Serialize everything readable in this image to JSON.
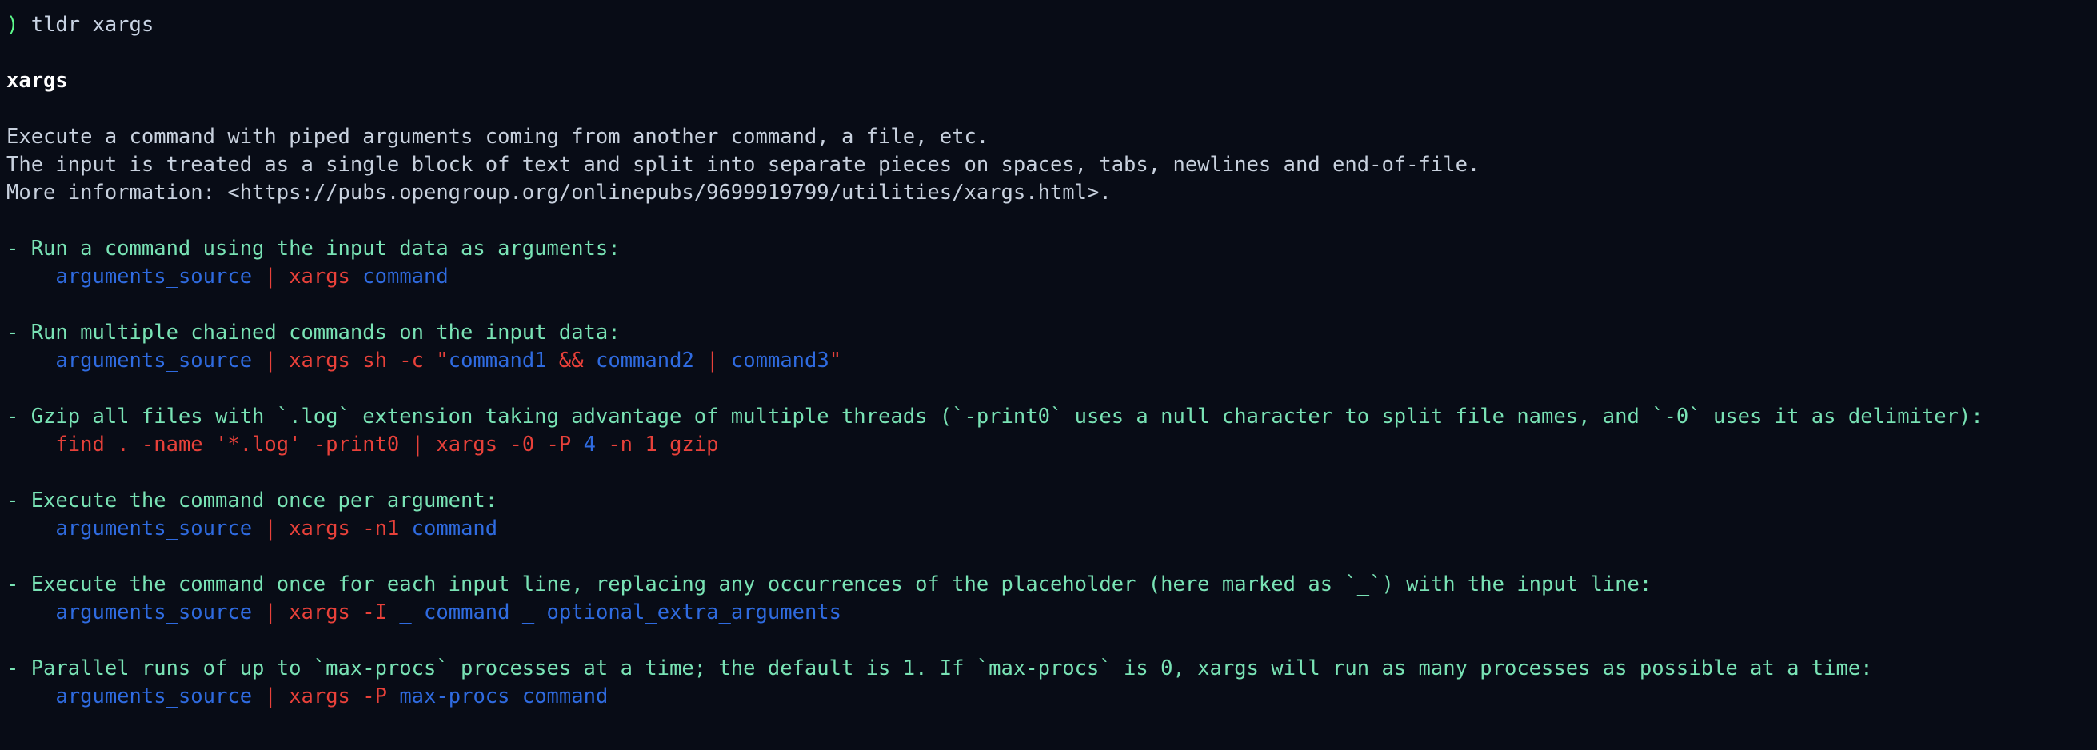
{
  "terminal": {
    "background_color": "#080c16",
    "prompt_symbol": ")",
    "prompt_symbol_color": "#5dfb8c",
    "command": "tldr xargs"
  },
  "page": {
    "title": "xargs",
    "description_lines": [
      "Execute a command with piped arguments coming from another command, a file, etc.",
      "The input is treated as a single block of text and split into separate pieces on spaces, tabs, newlines and end-of-file.",
      "More information: <https://pubs.opengroup.org/onlinepubs/9699919799/utilities/xargs.html>."
    ]
  },
  "colors": {
    "description_text": "#c8d1de",
    "example_description": "#79e3b5",
    "token_blue": "#2f6be0",
    "token_red": "#e8413a",
    "title": "#ffffff",
    "prompt_green": "#5dfb8c"
  },
  "examples": [
    {
      "description": "- Run a command using the input data as arguments:",
      "command_tokens": [
        {
          "text": "arguments_source",
          "color": "blue"
        },
        {
          "text": " ",
          "color": "plain"
        },
        {
          "text": "|",
          "color": "red"
        },
        {
          "text": " ",
          "color": "plain"
        },
        {
          "text": "xargs",
          "color": "red"
        },
        {
          "text": " ",
          "color": "plain"
        },
        {
          "text": "command",
          "color": "blue"
        }
      ]
    },
    {
      "description": "- Run multiple chained commands on the input data:",
      "command_tokens": [
        {
          "text": "arguments_source",
          "color": "blue"
        },
        {
          "text": " ",
          "color": "plain"
        },
        {
          "text": "|",
          "color": "red"
        },
        {
          "text": " ",
          "color": "plain"
        },
        {
          "text": "xargs sh -c ",
          "color": "red"
        },
        {
          "text": "\"",
          "color": "red"
        },
        {
          "text": "command1",
          "color": "blue"
        },
        {
          "text": " ",
          "color": "plain"
        },
        {
          "text": "&&",
          "color": "red"
        },
        {
          "text": " ",
          "color": "plain"
        },
        {
          "text": "command2",
          "color": "blue"
        },
        {
          "text": " ",
          "color": "plain"
        },
        {
          "text": "|",
          "color": "red"
        },
        {
          "text": " ",
          "color": "plain"
        },
        {
          "text": "command3",
          "color": "blue"
        },
        {
          "text": "\"",
          "color": "red"
        }
      ]
    },
    {
      "description": "- Gzip all files with `.log` extension taking advantage of multiple threads (`-print0` uses a null character to split file names, and `-0` uses it as delimiter):",
      "command_tokens": [
        {
          "text": "find . -name '*.log' -print0 ",
          "color": "red"
        },
        {
          "text": "|",
          "color": "red"
        },
        {
          "text": " ",
          "color": "plain"
        },
        {
          "text": "xargs -0 -P ",
          "color": "red"
        },
        {
          "text": "4",
          "color": "blue"
        },
        {
          "text": " ",
          "color": "plain"
        },
        {
          "text": "-n 1 gzip",
          "color": "red"
        }
      ]
    },
    {
      "description": "- Execute the command once per argument:",
      "command_tokens": [
        {
          "text": "arguments_source",
          "color": "blue"
        },
        {
          "text": " ",
          "color": "plain"
        },
        {
          "text": "|",
          "color": "red"
        },
        {
          "text": " ",
          "color": "plain"
        },
        {
          "text": "xargs -n1",
          "color": "red"
        },
        {
          "text": " ",
          "color": "plain"
        },
        {
          "text": "command",
          "color": "blue"
        }
      ]
    },
    {
      "description": "- Execute the command once for each input line, replacing any occurrences of the placeholder (here marked as `_`) with the input line:",
      "command_tokens": [
        {
          "text": "arguments_source",
          "color": "blue"
        },
        {
          "text": " ",
          "color": "plain"
        },
        {
          "text": "|",
          "color": "red"
        },
        {
          "text": " ",
          "color": "plain"
        },
        {
          "text": "xargs -I",
          "color": "red"
        },
        {
          "text": " ",
          "color": "plain"
        },
        {
          "text": "_ command _ optional_extra_arguments",
          "color": "blue"
        }
      ]
    },
    {
      "description": "- Parallel runs of up to `max-procs` processes at a time; the default is 1. If `max-procs` is 0, xargs will run as many processes as possible at a time:",
      "command_tokens": [
        {
          "text": "arguments_source",
          "color": "blue"
        },
        {
          "text": " ",
          "color": "plain"
        },
        {
          "text": "|",
          "color": "red"
        },
        {
          "text": " ",
          "color": "plain"
        },
        {
          "text": "xargs -P",
          "color": "red"
        },
        {
          "text": " ",
          "color": "plain"
        },
        {
          "text": "max-procs command",
          "color": "blue"
        }
      ]
    }
  ]
}
